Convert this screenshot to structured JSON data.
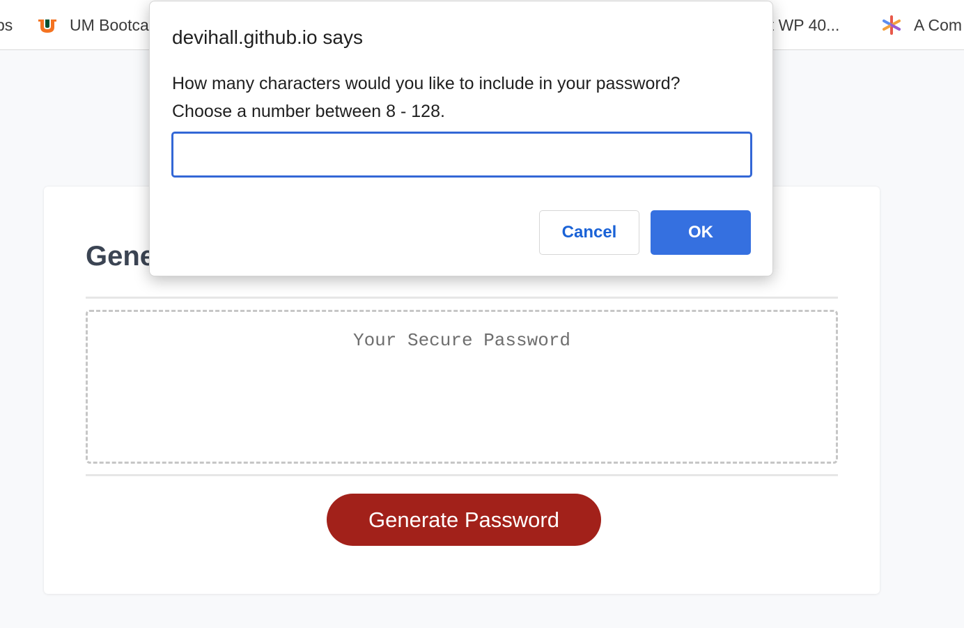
{
  "bookmarks_bar": {
    "items": [
      {
        "label": "ps",
        "icon": "none"
      },
      {
        "label": "UM Bootca",
        "icon": "um-logo-icon"
      },
      {
        "label": "nt WP 40...",
        "icon": "none"
      },
      {
        "label": "A Com",
        "icon": "colorful-asterisk-icon"
      }
    ]
  },
  "page": {
    "title": "Gene",
    "password_placeholder": "Your Secure Password",
    "generate_button_label": "Generate Password",
    "colors": {
      "generate_button": "#a2211a",
      "title": "#3b4453"
    }
  },
  "dialog": {
    "title": "devihall.github.io says",
    "message_line1": "How many characters would you like to include in your password?",
    "message_line2": "Choose a number between 8 - 128.",
    "input_value": "",
    "cancel_label": "Cancel",
    "ok_label": "OK",
    "colors": {
      "accent": "#3570e0",
      "focus_border": "#3367d6"
    }
  }
}
